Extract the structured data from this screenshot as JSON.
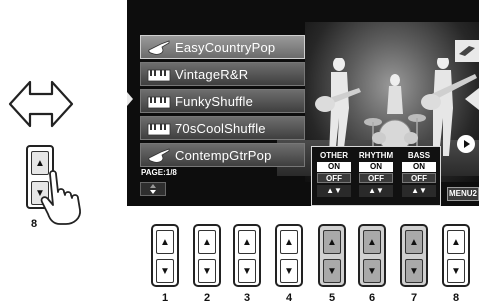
{
  "screen": {
    "voices": [
      {
        "label": "EasyCountryPop",
        "icon": "guitar-voice-icon",
        "selected": true
      },
      {
        "label": "VintageR&R",
        "icon": "piano-voice-icon",
        "selected": false
      },
      {
        "label": "FunkyShuffle",
        "icon": "piano-voice-icon",
        "selected": false
      },
      {
        "label": "70sCoolShuffle",
        "icon": "piano-voice-icon",
        "selected": false
      },
      {
        "label": "ContempGtrPop",
        "icon": "guitar-voice-icon",
        "selected": false
      }
    ],
    "page_label": "PAGE:1/8",
    "page_button": "▲\n▼",
    "parts": [
      {
        "name": "OTHER",
        "on": "ON",
        "off": "OFF",
        "arrows": "▲▼"
      },
      {
        "name": "RHYTHM",
        "on": "ON",
        "off": "OFF",
        "arrows": "▲▼"
      },
      {
        "name": "BASS",
        "on": "ON",
        "off": "OFF",
        "arrows": "▲▼"
      }
    ],
    "menu_label": "MENU2"
  },
  "left_control": {
    "arrow_up": "▲",
    "arrow_down": "▼",
    "number": "8"
  },
  "buttons": [
    {
      "number": "1",
      "up": "▲",
      "down": "▼",
      "highlighted": false
    },
    {
      "number": "2",
      "up": "▲",
      "down": "▼",
      "highlighted": false
    },
    {
      "number": "3",
      "up": "▲",
      "down": "▼",
      "highlighted": false
    },
    {
      "number": "4",
      "up": "▲",
      "down": "▼",
      "highlighted": false
    },
    {
      "number": "5",
      "up": "▲",
      "down": "▼",
      "highlighted": true
    },
    {
      "number": "6",
      "up": "▲",
      "down": "▼",
      "highlighted": true
    },
    {
      "number": "7",
      "up": "▲",
      "down": "▼",
      "highlighted": true
    },
    {
      "number": "8",
      "up": "▲",
      "down": "▼",
      "highlighted": false
    }
  ]
}
